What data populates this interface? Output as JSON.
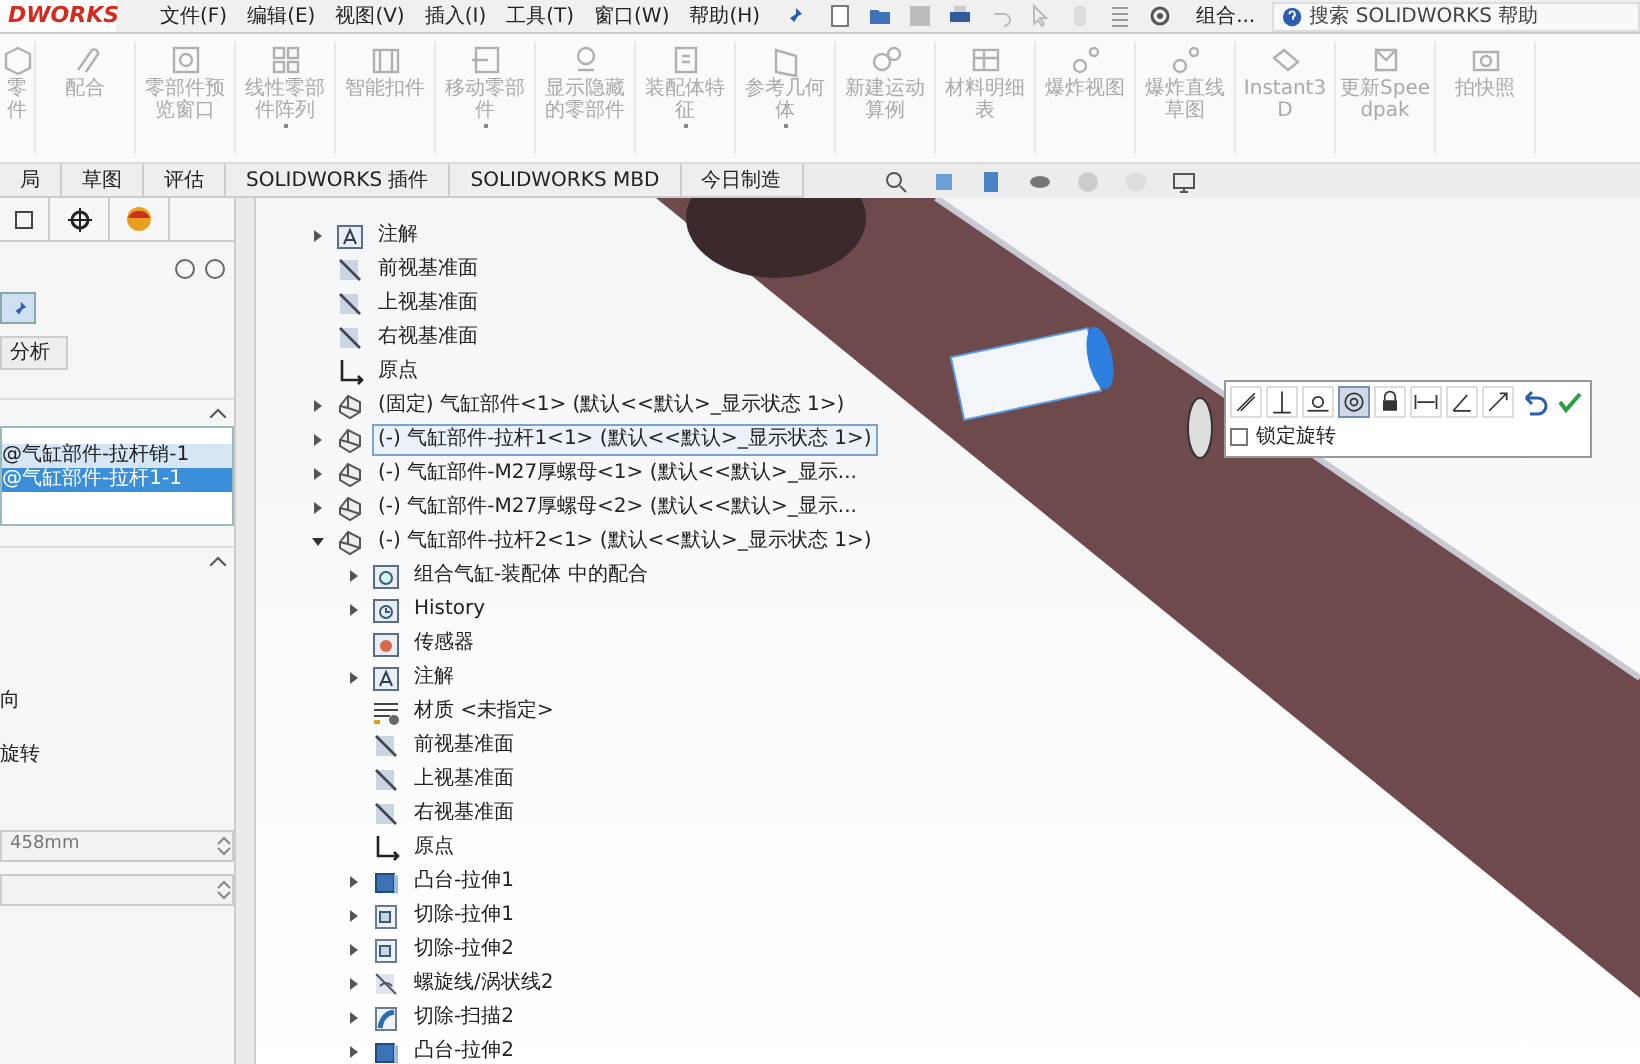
{
  "app": {
    "logo": "DWORKS",
    "menu": [
      "文件(F)",
      "编辑(E)",
      "视图(V)",
      "插入(I)",
      "工具(T)",
      "窗口(W)",
      "帮助(H)"
    ],
    "quick_combo": "组合...",
    "search": {
      "placeholder": "搜索 SOLIDWORKS 帮助"
    }
  },
  "ribbon": [
    {
      "label": "零件",
      "kind": "part",
      "dropdown": false
    },
    {
      "label": "配合",
      "kind": "clip",
      "dropdown": false
    },
    {
      "label": "零部件预览窗口",
      "kind": "window",
      "dropdown": false
    },
    {
      "label": "线性零部件阵列",
      "kind": "pattern",
      "dropdown": true
    },
    {
      "label": "智能扣件",
      "kind": "fastener",
      "dropdown": false
    },
    {
      "label": "移动零部件",
      "kind": "move",
      "dropdown": true
    },
    {
      "label": "显示隐藏的零部件",
      "kind": "show",
      "dropdown": false
    },
    {
      "label": "装配体特征",
      "kind": "feature",
      "dropdown": true
    },
    {
      "label": "参考几何体",
      "kind": "reference",
      "dropdown": true
    },
    {
      "label": "新建运动算例",
      "kind": "motion",
      "dropdown": false
    },
    {
      "label": "材料明细表",
      "kind": "table",
      "dropdown": false
    },
    {
      "label": "爆炸视图",
      "kind": "explode",
      "dropdown": false
    },
    {
      "label": "爆炸直线草图",
      "kind": "explode",
      "dropdown": false
    },
    {
      "label": "Instant3D",
      "kind": "instant",
      "dropdown": false
    },
    {
      "label": "更新Speedpak",
      "kind": "speedpak",
      "dropdown": false
    },
    {
      "label": "拍快照",
      "kind": "camera",
      "dropdown": false
    }
  ],
  "tabs": [
    {
      "label": "局",
      "selected": false
    },
    {
      "label": "草图",
      "selected": false
    },
    {
      "label": "评估",
      "selected": false
    },
    {
      "label": "SOLIDWORKS 插件",
      "selected": false
    },
    {
      "label": "SOLIDWORKS MBD",
      "selected": false
    },
    {
      "label": "今日制造",
      "selected": false
    }
  ],
  "property_manager": {
    "sub_tab": "分析",
    "selections": [
      {
        "label": "@气缸部件-拉杆销-1",
        "selected": false
      },
      {
        "label": "@气缸部件-拉杆1-1",
        "selected": true
      }
    ],
    "option_1": "向",
    "option_2": "旋转",
    "distance_field": {
      "value": "458mm"
    }
  },
  "tree": [
    {
      "label": "注解",
      "kind": "annotation",
      "expanded": false
    },
    {
      "label": "前视基准面",
      "kind": "plane"
    },
    {
      "label": "上视基准面",
      "kind": "plane"
    },
    {
      "label": "右视基准面",
      "kind": "plane"
    },
    {
      "label": "原点",
      "kind": "origin"
    },
    {
      "label": "(固定) 气缸部件<1> (默认<<默认>_显示状态 1>)",
      "kind": "component",
      "expanded": false,
      "selected": false
    },
    {
      "label": "(-) 气缸部件-拉杆1<1> (默认<<默认>_显示状态 1>)",
      "kind": "component",
      "expanded": false,
      "selected": true
    },
    {
      "label": "(-) 气缸部件-M27厚螺母<1> (默认<<默认>_显示...",
      "kind": "component",
      "expanded": false,
      "selected": false
    },
    {
      "label": "(-) 气缸部件-M27厚螺母<2> (默认<<默认>_显示...",
      "kind": "component",
      "expanded": false,
      "selected": false
    },
    {
      "label": "(-) 气缸部件-拉杆2<1> (默认<<默认>_显示状态 1>)",
      "kind": "component",
      "expanded": true,
      "selected": false,
      "children": [
        {
          "label": "组合气缸-装配体 中的配合",
          "kind": "mates",
          "expanded": false
        },
        {
          "label": "History",
          "kind": "history",
          "expanded": false
        },
        {
          "label": "传感器",
          "kind": "sensor"
        },
        {
          "label": "注解",
          "kind": "annotation",
          "expanded": false
        },
        {
          "label": "材质 <未指定>",
          "kind": "material"
        },
        {
          "label": "前视基准面",
          "kind": "plane"
        },
        {
          "label": "上视基准面",
          "kind": "plane"
        },
        {
          "label": "右视基准面",
          "kind": "plane"
        },
        {
          "label": "原点",
          "kind": "origin"
        },
        {
          "label": "凸台-拉伸1",
          "kind": "boss",
          "expanded": false
        },
        {
          "label": "切除-拉伸1",
          "kind": "cut",
          "expanded": false
        },
        {
          "label": "切除-拉伸2",
          "kind": "cut",
          "expanded": false
        },
        {
          "label": "螺旋线/涡状线2",
          "kind": "helix",
          "expanded": false
        },
        {
          "label": "切除-扫描2",
          "kind": "sweep",
          "expanded": false
        },
        {
          "label": "凸台-拉伸2",
          "kind": "boss",
          "expanded": false
        }
      ]
    }
  ],
  "mate_toolbar": {
    "lock_rotation": {
      "label": "锁定旋转",
      "checked": false
    }
  }
}
